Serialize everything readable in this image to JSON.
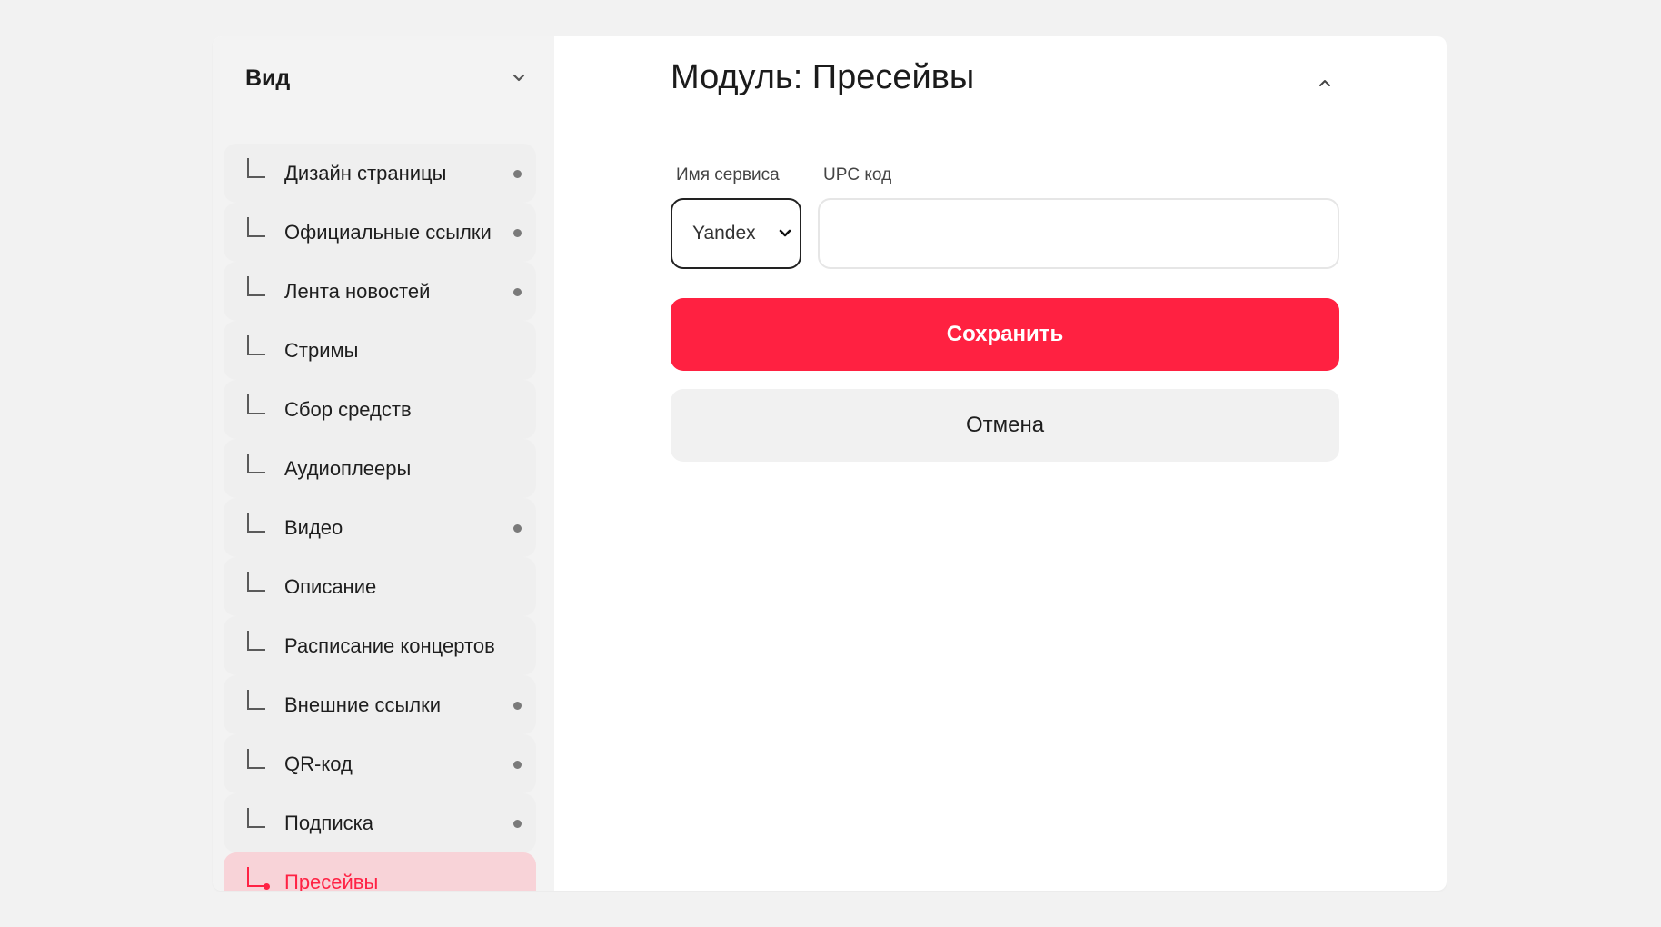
{
  "sidebar": {
    "title": "Вид",
    "items": [
      {
        "label": "Дизайн страницы",
        "has_dot": true,
        "active": false
      },
      {
        "label": "Официальные ссылки",
        "has_dot": true,
        "active": false
      },
      {
        "label": "Лента новостей",
        "has_dot": true,
        "active": false
      },
      {
        "label": "Стримы",
        "has_dot": false,
        "active": false
      },
      {
        "label": "Сбор средств",
        "has_dot": false,
        "active": false
      },
      {
        "label": "Аудиоплееры",
        "has_dot": false,
        "active": false
      },
      {
        "label": "Видео",
        "has_dot": true,
        "active": false
      },
      {
        "label": "Описание",
        "has_dot": false,
        "active": false
      },
      {
        "label": "Расписание концертов",
        "has_dot": false,
        "active": false
      },
      {
        "label": "Внешние ссылки",
        "has_dot": true,
        "active": false
      },
      {
        "label": "QR-код",
        "has_dot": true,
        "active": false
      },
      {
        "label": "Подписка",
        "has_dot": true,
        "active": false
      },
      {
        "label": "Пресейвы",
        "has_dot": false,
        "active": true
      }
    ]
  },
  "module": {
    "title": "Модуль: Пресейвы",
    "service_label": "Имя сервиса",
    "service_value": "Yandex",
    "upc_label": "UPC код",
    "upc_value": "",
    "save_label": "Сохранить",
    "cancel_label": "Отмена"
  },
  "icons": {
    "sidebar_toggle": "chevron-down-icon",
    "module_toggle": "chevron-up-icon",
    "select_arrow": "chevron-down-icon"
  },
  "colors": {
    "accent": "#ff2141",
    "active_bg": "#f8d3d8",
    "page_bg": "#f2f2f2",
    "sidebar_bg": "#f3f3f3"
  }
}
